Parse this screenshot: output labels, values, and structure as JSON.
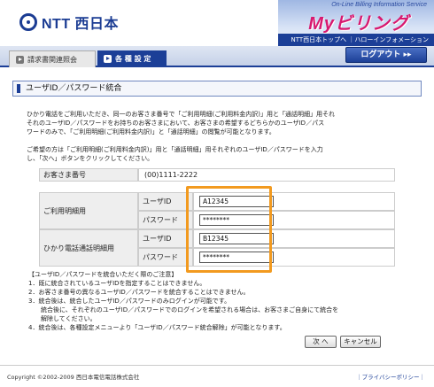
{
  "header": {
    "logo_text": "NTT 西日本",
    "online_text": "On-Line Billing Information Service",
    "brand_title": "Myビリング",
    "top_links": "NTT西日本トップへ ｜ハローインフォメーション"
  },
  "tabs": [
    {
      "label": "請求書関連照会"
    },
    {
      "label": "各 種 設 定"
    }
  ],
  "logout_label": "ログアウト ▸▸",
  "page_title": "ユーザID／パスワード統合",
  "intro": [
    "ひかり電話をご利用いただき、同一のお客さま番号で「ご利用明細(ご利用料金内訳)」用と「通話明細」用それ",
    "それのユーザID／パスワードをお持ちのお客さまにおいて、お客さまの希望するどちらかのユーザID／パス",
    "ワードのみで、「ご利用明細(ご利用料金内訳)」と「通話明細」の閲覧が可能となります。"
  ],
  "intro2": [
    "ご希望の方は「ご利用明細(ご利用料金内訳)」用と「通話明細」用それぞれのユーザID／パスワードを入力",
    "し、「次へ」ボタンをクリックしてください。"
  ],
  "customer": {
    "label": "お客さま番号",
    "value": "(00)1111-2222"
  },
  "accounts": [
    {
      "group": "ご利用明細用",
      "id_label": "ユーザID",
      "pw_label": "パスワード",
      "id_value": "A12345",
      "pw_value": "********"
    },
    {
      "group": "ひかり電話通話明細用",
      "id_label": "ユーザID",
      "pw_label": "パスワード",
      "id_value": "B12345",
      "pw_value": "********"
    }
  ],
  "notes": [
    "【ユーザID／パスワードを統合いただく際のご注意】",
    "1．既に統合されているユーザIDを指定することはできません。",
    "2．お客さま番号の異なるユーザID／パスワードを統合することはできません。",
    "3．統合後は、統合したユーザID／パスワードのみログインが可能です。",
    "　　統合後に、それぞれのユーザID／パスワードでのログインを希望される場合は、お客さまご自身にて統合を",
    "　　解除してください。",
    "4．統合後は、各種設定メニューより「ユーザID／パスワード統合解除」が可能となります。"
  ],
  "buttons": {
    "next": "次 へ",
    "cancel": "キャンセル"
  },
  "footer": {
    "copyright": "Copyright ©2002-2009 西日本電信電話株式会社",
    "privacy": "｜プライバシーポリシー｜"
  }
}
